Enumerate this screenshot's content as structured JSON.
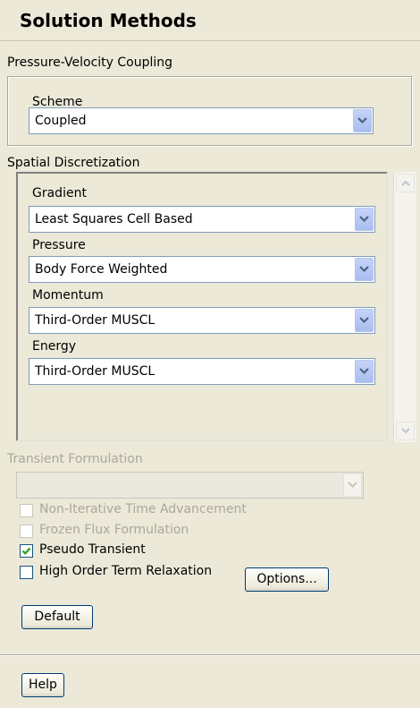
{
  "panel": {
    "title": "Solution Methods"
  },
  "pv_coupling": {
    "group_label": "Pressure-Velocity Coupling",
    "scheme_label": "Scheme",
    "scheme_value": "Coupled"
  },
  "spatial": {
    "group_label": "Spatial Discretization",
    "gradient_label": "Gradient",
    "gradient_value": "Least Squares Cell Based",
    "pressure_label": "Pressure",
    "pressure_value": "Body Force Weighted",
    "momentum_label": "Momentum",
    "momentum_value": "Third-Order MUSCL",
    "energy_label": "Energy",
    "energy_value": "Third-Order MUSCL"
  },
  "transient": {
    "label": "Transient Formulation",
    "value": ""
  },
  "options": {
    "non_iterative": {
      "label": "Non-Iterative Time Advancement",
      "checked": false,
      "enabled": false
    },
    "frozen_flux": {
      "label": "Frozen Flux Formulation",
      "checked": false,
      "enabled": false
    },
    "pseudo_transient": {
      "label": "Pseudo Transient",
      "checked": true,
      "enabled": true
    },
    "high_order": {
      "label": "High Order Term Relaxation",
      "checked": false,
      "enabled": true
    },
    "options_button": "Options..."
  },
  "buttons": {
    "default": "Default",
    "help": "Help"
  },
  "icons": {
    "dropdown": "chevron-down-icon",
    "scroll_up": "arrow-up-icon",
    "scroll_down": "arrow-down-icon",
    "check": "checkmark-icon"
  },
  "colors": {
    "background": "#ece9d8",
    "dropdown_button": "#b5c6ef",
    "check_green": "#21a121"
  }
}
